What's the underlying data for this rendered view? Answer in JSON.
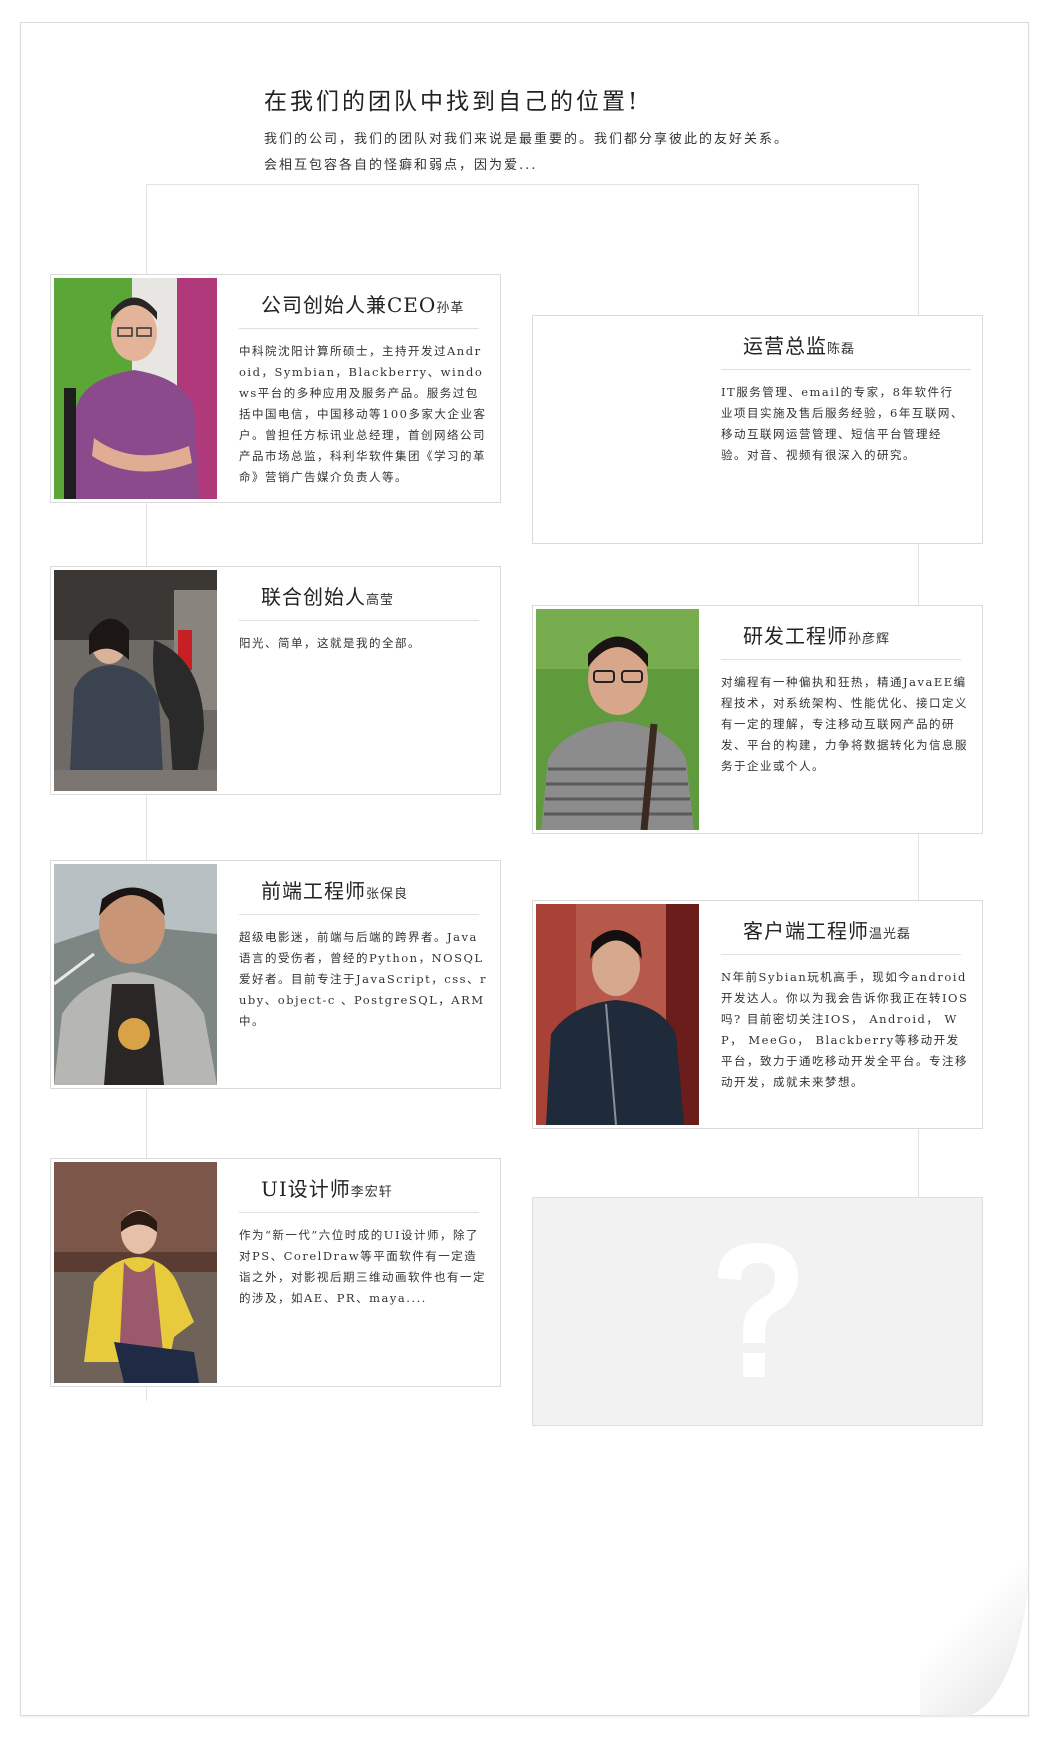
{
  "intro": {
    "title": "在我们的团队中找到自己的位置!",
    "line1": "我们的公司，我们的团队对我们来说是最重要的。我们都分享彼此的友好关系。",
    "line2": "会相互包容各自的怪癖和弱点，因为爱..."
  },
  "members": [
    {
      "role": "公司创始人兼CEO",
      "name": "孙革",
      "photo": "photo-man-purple-shirt",
      "desc": "中科院沈阳计算所硕士，主持开发过Android，Symbian，Blackberry、windows平台的多种应用及服务产品。服务过包括中国电信，中国移动等100多家大企业客户。曾担任方标讯业总经理，首创网络公司产品市场总监，科利华软件集团《学习的革命》营销广告媒介负责人等。"
    },
    {
      "role": "运营总监",
      "name": "陈磊",
      "photo": "",
      "desc": "IT服务管理、email的专家，8年软件行业项目实施及售后服务经验，6年互联网、移动互联网运营管理、短信平台管理经验。对音、视频有很深入的研究。"
    },
    {
      "role": "联合创始人",
      "name": "高莹",
      "photo": "photo-woman-with-horse",
      "desc": "阳光、简单，这就是我的全部。"
    },
    {
      "role": "研发工程师",
      "name": "孙彦辉",
      "photo": "photo-man-glasses-striped-shirt",
      "desc": "对编程有一种偏执和狂热，精通JavaEE编程技术，对系统架构、性能优化、接口定义有一定的理解，专注移动互联网产品的研发、平台的构建，力争将数据转化为信息服务于企业或个人。"
    },
    {
      "role": "前端工程师",
      "name": "张保良",
      "photo": "photo-man-grey-jacket",
      "desc": "超级电影迷，前端与后端的跨界者。Java语言的受伤者，曾经的Python，NOSQL爱好者。目前专注于JavaScript，css、ruby、object-c 、PostgreSQL，ARM中。"
    },
    {
      "role": "客户端工程师",
      "name": "温光磊",
      "photo": "photo-young-man-dark-jacket",
      "desc": "N年前Sybian玩机高手，现如今android开发达人。你以为我会告诉你我正在转IOS吗? 目前密切关注IOS， Android， WP， MeeGo， Blackberry等移动开发平台，致力于通吃移动开发全平台。专注移动开发，成就未来梦想。"
    },
    {
      "role": "UI设计师",
      "name": "李宏轩",
      "photo": "photo-woman-yellow-sweater",
      "desc": "作为“新一代”六位时成的UI设计师，除了对PS、CorelDraw等平面软件有一定造诣之外，对影视后期三维动画软件也有一定的涉及，如AE、PR、maya...."
    }
  ],
  "placeholder": {
    "icon": "question-mark-icon"
  }
}
